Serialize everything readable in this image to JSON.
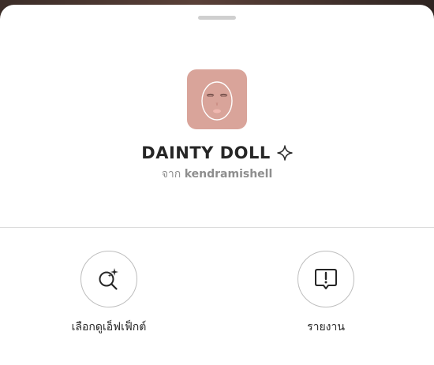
{
  "effect": {
    "name": "DAINTY DOLL",
    "by_prefix": "จาก",
    "creator": "kendramishell",
    "thumbnail_bg": "#d9a49a"
  },
  "actions": [
    {
      "label": "เลือกดูเอ็ฟเฟ็กต์",
      "icon": "search-sparkle-icon"
    },
    {
      "label": "รายงาน",
      "icon": "report-icon"
    }
  ],
  "colors": {
    "sheet": "#ffffff",
    "text": "#262626",
    "muted": "#8e8e8e",
    "border": "#dbdbdb"
  }
}
